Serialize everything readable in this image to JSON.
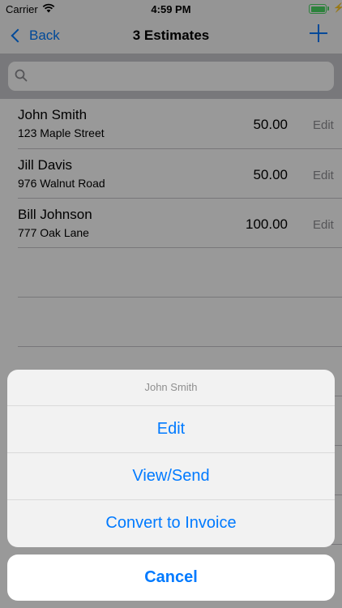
{
  "status_bar": {
    "carrier": "Carrier",
    "time": "4:59 PM"
  },
  "nav": {
    "back_label": "Back",
    "title": "3 Estimates"
  },
  "search": {
    "placeholder": ""
  },
  "estimates": [
    {
      "name": "John Smith",
      "address": "123 Maple Street",
      "amount": "50.00",
      "edit_label": "Edit"
    },
    {
      "name": "Jill Davis",
      "address": "976 Walnut Road",
      "amount": "50.00",
      "edit_label": "Edit"
    },
    {
      "name": "Bill Johnson",
      "address": "777 Oak Lane",
      "amount": "100.00",
      "edit_label": "Edit"
    }
  ],
  "action_sheet": {
    "title": "John Smith",
    "actions": [
      "Edit",
      "View/Send",
      "Convert to Invoice"
    ],
    "cancel": "Cancel"
  },
  "colors": {
    "accent": "#007aff",
    "battery": "#4cd964",
    "secondary_text": "#8e8e93"
  },
  "icons": [
    "wifi-icon",
    "battery-icon",
    "charging-icon",
    "chevron-left-icon",
    "plus-icon",
    "search-icon"
  ]
}
